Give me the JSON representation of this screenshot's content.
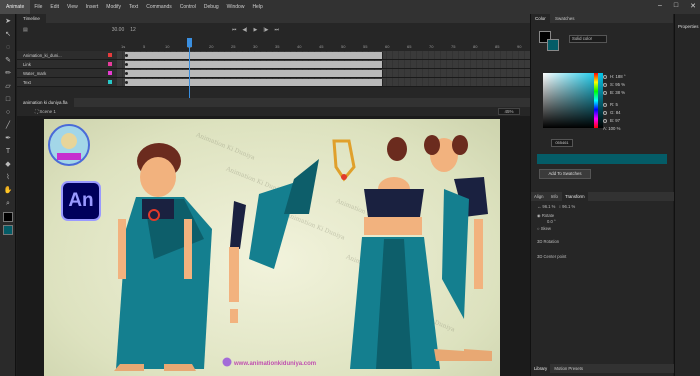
{
  "app": {
    "brand": "Animate"
  },
  "menu": [
    "File",
    "Edit",
    "View",
    "Insert",
    "Modify",
    "Text",
    "Commands",
    "Control",
    "Debug",
    "Window",
    "Help"
  ],
  "timeline": {
    "tab": "Timeline",
    "fps": "30.00",
    "frame": "12",
    "ruler": [
      "1s",
      "5",
      "10",
      "15",
      "20",
      "25",
      "30",
      "35",
      "40",
      "45",
      "50",
      "55",
      "60",
      "65",
      "70",
      "75",
      "80",
      "85",
      "90"
    ],
    "layers": [
      {
        "name": "Animation_ki_duni...",
        "color": "#e63c3c"
      },
      {
        "name": "Link",
        "color": "#e63c9c"
      },
      {
        "name": "Water_mark",
        "color": "#e63cd2"
      },
      {
        "name": "Text",
        "color": "#28c8c8"
      }
    ]
  },
  "document": {
    "tab": "animation ki duniya.fla",
    "scene": "Scene 1",
    "zoom": "45%"
  },
  "stage": {
    "logo_text": "An",
    "watermark": "Animation Ki Duniya",
    "site": "www.animationkiduniya.com"
  },
  "color_panel": {
    "tabs": [
      "Color",
      "Swatches"
    ],
    "fill_type": "Solid color",
    "values": {
      "H": "188 °",
      "S": "95 %",
      "B": "38 %",
      "R": "5",
      "G": "84",
      "B2": "97",
      "A": "100 %"
    },
    "hex": "055461",
    "current_color": "#045c67",
    "add_button": "Add To Swatches"
  },
  "transform_panel": {
    "tabs": [
      "Align",
      "Info",
      "Transform"
    ],
    "scale": "96.1 %",
    "scale_y": "96.1 %",
    "rotate_label": "Rotate",
    "rotate_value": "0.0 °",
    "skew_label": "Skew",
    "section1": "3D Rotation",
    "section2": "3D Center point"
  },
  "library": {
    "tabs": [
      "Library",
      "Motion Presets"
    ]
  },
  "properties": {
    "label": "Properties"
  }
}
